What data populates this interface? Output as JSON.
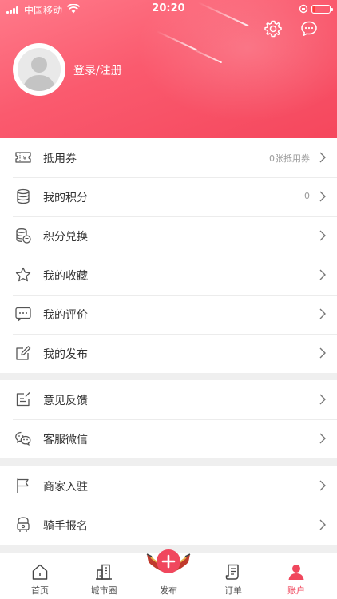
{
  "status_bar": {
    "carrier": "中国移动",
    "time": "20:20"
  },
  "profile": {
    "login_label": "登录/注册"
  },
  "menu_group_1": [
    {
      "label": "抵用券",
      "value": "0张抵用券",
      "icon": "coupon-icon"
    },
    {
      "label": "我的积分",
      "value": "0",
      "icon": "coins-icon"
    },
    {
      "label": "积分兑换",
      "value": "",
      "icon": "exchange-icon"
    },
    {
      "label": "我的收藏",
      "value": "",
      "icon": "star-icon"
    },
    {
      "label": "我的评价",
      "value": "",
      "icon": "comment-icon"
    },
    {
      "label": "我的发布",
      "value": "",
      "icon": "edit-icon"
    }
  ],
  "menu_group_2": [
    {
      "label": "意见反馈",
      "value": "",
      "icon": "feedback-icon"
    },
    {
      "label": "客服微信",
      "value": "",
      "icon": "wechat-icon"
    }
  ],
  "menu_group_3": [
    {
      "label": "商家入驻",
      "value": "",
      "icon": "flag-icon"
    },
    {
      "label": "骑手报名",
      "value": "",
      "icon": "rider-icon"
    }
  ],
  "tabbar": [
    {
      "label": "首页",
      "icon": "home-icon"
    },
    {
      "label": "城市圈",
      "icon": "city-icon"
    },
    {
      "label": "发布",
      "icon": "plus-icon"
    },
    {
      "label": "订单",
      "icon": "order-icon"
    },
    {
      "label": "账户",
      "icon": "account-icon",
      "active": true
    }
  ],
  "colors": {
    "accent": "#f0475d",
    "header_start": "#ff7a8a",
    "header_end": "#f5475d"
  }
}
